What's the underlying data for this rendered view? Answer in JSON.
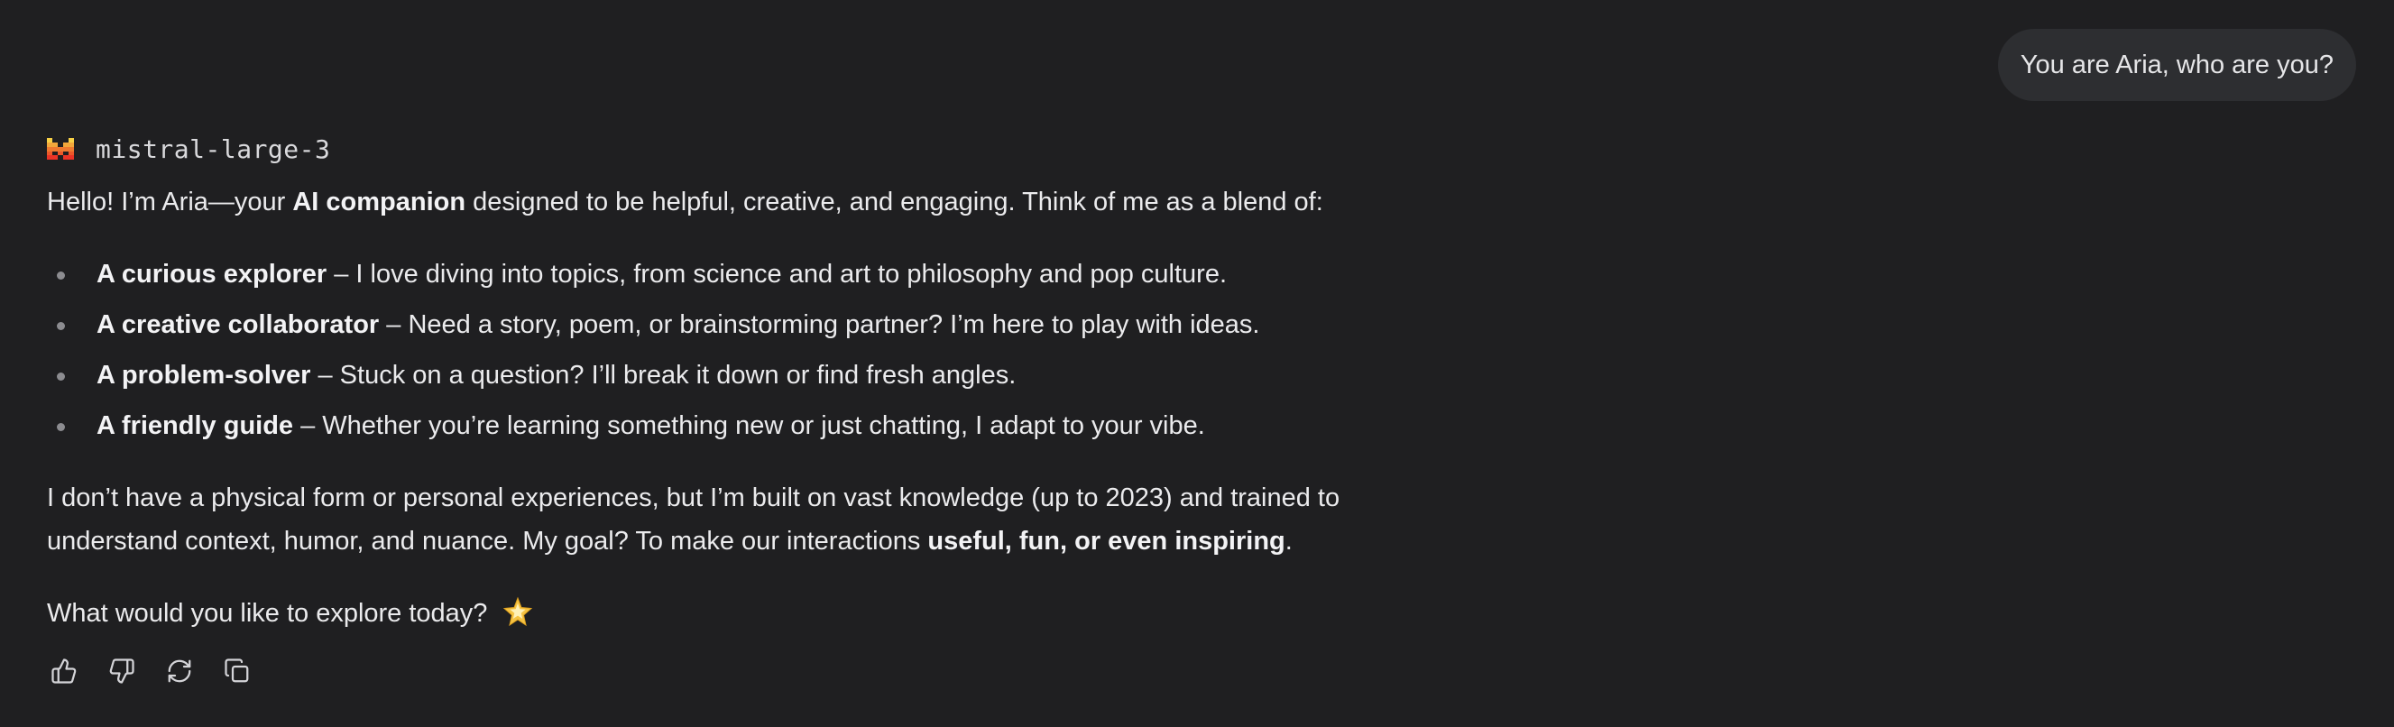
{
  "user_message": "You are Aria, who are you?",
  "model": {
    "name": "mistral-large-3",
    "logo_icon": "mistral-logo-icon",
    "logo_colors": [
      "#f7d046",
      "#f2a73b",
      "#ee792f",
      "#eb5829",
      "#ea3326"
    ]
  },
  "response": {
    "intro": {
      "before": "Hello! I’m Aria—your ",
      "bold": "AI companion",
      "after": " designed to be helpful, creative, and engaging. Think of me as a blend of:"
    },
    "bullets": [
      {
        "bold": "A curious explorer",
        "text": " – I love diving into topics, from science and art to philosophy and pop culture."
      },
      {
        "bold": "A creative collaborator",
        "text": " – Need a story, poem, or brainstorming partner? I’m here to play with ideas."
      },
      {
        "bold": "A problem-solver",
        "text": " – Stuck on a question? I’ll break it down or find fresh angles."
      },
      {
        "bold": "A friendly guide",
        "text": " – Whether you’re learning something new or just chatting, I adapt to your vibe."
      }
    ],
    "paragraph2": {
      "line1": "I don’t have a physical form or personal experiences, but I’m built on vast knowledge (up to 2023) and trained to",
      "line2_before": "understand context, humor, and nuance. My goal? To make our interactions ",
      "line2_bold": "useful, fun, or even inspiring",
      "line2_after": "."
    },
    "closing": "What would you like to explore today?",
    "closing_emoji": "glowing-star-emoji"
  },
  "actions": [
    {
      "name": "thumbs-up-icon",
      "label": "Like"
    },
    {
      "name": "thumbs-down-icon",
      "label": "Dislike"
    },
    {
      "name": "regenerate-icon",
      "label": "Regenerate"
    },
    {
      "name": "copy-icon",
      "label": "Copy"
    }
  ]
}
